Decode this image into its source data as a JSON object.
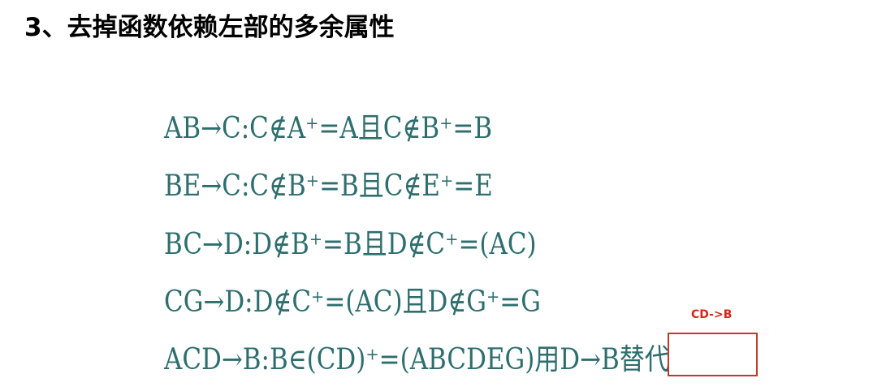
{
  "heading": "3、去掉函数依赖左部的多余属性",
  "lines": [
    "AB→C:C∉A⁺=A且C∉B⁺=B",
    "BE→C:C∉B⁺=B且C∉E⁺=E",
    "BC→D:D∉B⁺=B且D∉C⁺=(AC)",
    "CG→D:D∉C⁺=(AC)且D∉G⁺=G",
    "ACD→B:B∈(CD)⁺=(ABCDEG)用D→B替代"
  ],
  "annotation": "CD->B",
  "colors": {
    "formula_text": "#2e6e6e",
    "annotation_text": "#d0281c",
    "box_border": "#c0392b"
  }
}
